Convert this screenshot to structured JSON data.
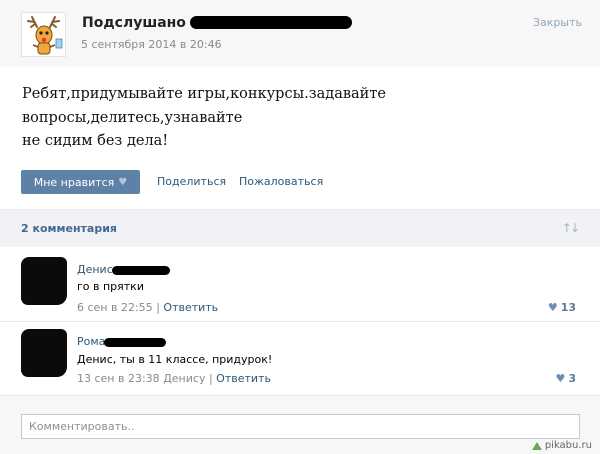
{
  "post": {
    "group_name": "Подслушано",
    "date": "5 сентября 2014 в 20:46",
    "close_label": "Закрыть",
    "text": "Ребят,придумывайте игры,конкурсы.задавайте\nвопросы,делитесь,узнавайте\nне сидим без дела!",
    "like_label": "Мне нравится",
    "share_label": "Поделиться",
    "report_label": "Пожаловаться"
  },
  "comments_header": {
    "count_label": "2 комментария",
    "sort_icon": "sort-arrows-icon"
  },
  "comments": [
    {
      "author": "Денис",
      "text": "го в прятки",
      "date": "6 сен в 22:55",
      "separator": "|",
      "reply_label": "Ответить",
      "likes": "13"
    },
    {
      "author": "Рома",
      "text": "Денис, ты в 11 классе, придурок!",
      "date": "13 сен в 23:38",
      "reply_to": "Денису",
      "separator": "|",
      "reply_label": "Ответить",
      "likes": "3"
    }
  ],
  "comment_box": {
    "placeholder": "Комментировать.."
  },
  "watermark": "pikabu.ru",
  "colors": {
    "accent": "#5e81a8",
    "link": "#2b587a",
    "meta": "#8a8a8a"
  }
}
